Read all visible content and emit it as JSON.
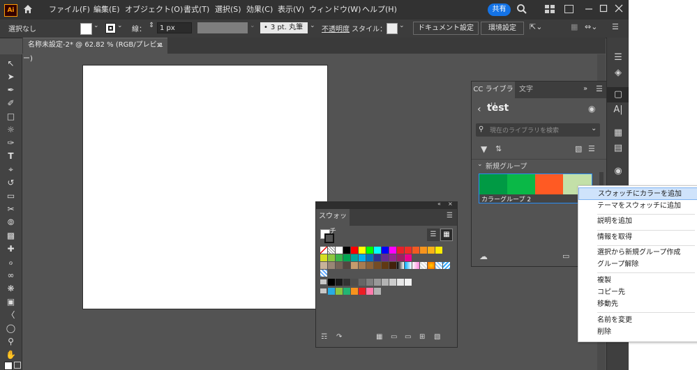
{
  "app": {
    "logo": "Ai",
    "share_label": "共有"
  },
  "menu": [
    "ファイル(F)",
    "編集(E)",
    "オブジェクト(O)",
    "書式(T)",
    "選択(S)",
    "効果(C)",
    "表示(V)",
    "ウィンドウ(W)",
    "ヘルプ(H)"
  ],
  "control": {
    "selection": "選択なし",
    "stroke_label": "線：",
    "stroke_value": "1 px",
    "brush": "3 pt. 丸筆",
    "opacity_label": "不透明度",
    "style_label": "スタイル：",
    "doc_setup": "ドキュメント設定",
    "prefs": "環境設定"
  },
  "document": {
    "tab_title": "名称未設定-2* @ 62.82 % (RGB/プレビュー)",
    "close": "×"
  },
  "library": {
    "tab_cc": "CC ライブラリ",
    "tab_char": "文字",
    "title": "test",
    "search_placeholder": "現在のライブラリを検索",
    "group_label": "新規グループ",
    "color_group_label": "カラーグループ 2",
    "color_group_colors": [
      "#009a44",
      "#0ab847",
      "#ff5a23",
      "#c3e0a8"
    ]
  },
  "swatches": {
    "title": "スウォッチ",
    "row1": [
      "#ffffff",
      "#000000",
      "#ff0000",
      "#ffff00",
      "#00ff00",
      "#00ffff",
      "#0000ff",
      "#ff00ff",
      "#e8202a",
      "#ef2f26",
      "#f15a22",
      "#f7941d",
      "#f9b218",
      "#ffed00"
    ],
    "row2": [
      "#d7df23",
      "#8dc63f",
      "#39b54a",
      "#00a651",
      "#00a79d",
      "#00aeef",
      "#0072bc",
      "#2e3192",
      "#662d91",
      "#92278f",
      "#9e1f63",
      "#ec008c"
    ],
    "row3": [
      "#c7b299",
      "#998675",
      "#736357",
      "#534741",
      "#c69c6d",
      "#a67c52",
      "#8c6239",
      "#754c24",
      "#603913",
      "#42210b"
    ],
    "gray_row": [
      "#000000",
      "#1a1a1a",
      "#333333",
      "#4d4d4d",
      "#666666",
      "#808080",
      "#999999",
      "#b3b3b3",
      "#cccccc",
      "#e6e6e6",
      "#f2f2f2"
    ],
    "color_row": [
      "#29abe2",
      "#8cc63f",
      "#22b573",
      "#f7931e",
      "#ed1c24",
      "#ff7bac",
      "#b3b3b3"
    ]
  },
  "context_menu": {
    "items": [
      "スウォッチにカラーを追加",
      "テーマをスウォッチに追加",
      "説明を追加",
      "情報を取得",
      "選択から新規グループ作成",
      "グループ解除",
      "複製",
      "コピー先",
      "移動先",
      "名前を変更",
      "削除"
    ],
    "highlighted_index": 0
  }
}
